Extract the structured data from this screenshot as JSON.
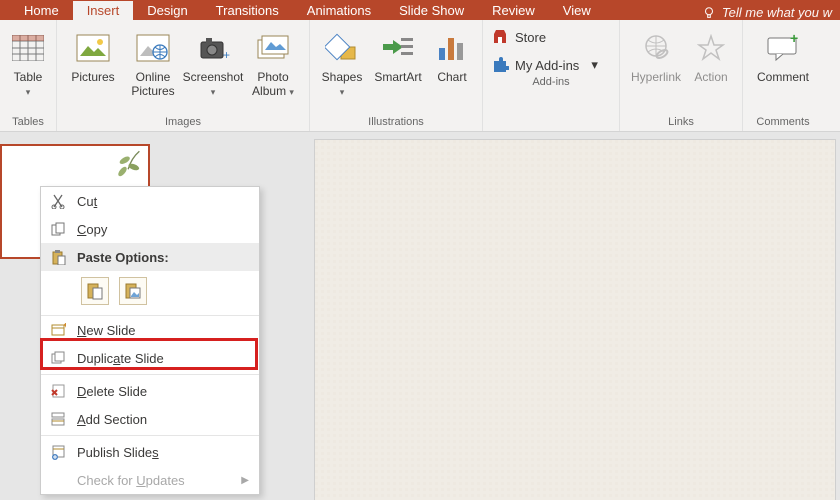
{
  "tabs": {
    "home": "Home",
    "insert": "Insert",
    "design": "Design",
    "transitions": "Transitions",
    "animations": "Animations",
    "slideshow": "Slide Show",
    "review": "Review",
    "view": "View",
    "tellme": "Tell me what you w"
  },
  "ribbon": {
    "tables": {
      "table": "Table",
      "group": "Tables"
    },
    "images": {
      "pictures": "Pictures",
      "online_pictures": "Online Pictures",
      "screenshot": "Screenshot",
      "photo_album": "Photo Album",
      "group": "Images"
    },
    "illustrations": {
      "shapes": "Shapes",
      "smartart": "SmartArt",
      "chart": "Chart",
      "group": "Illustrations"
    },
    "addins": {
      "store": "Store",
      "my_addins": "My Add-ins",
      "group": "Add-ins"
    },
    "links": {
      "hyperlink": "Hyperlink",
      "action": "Action",
      "group": "Links"
    },
    "comments": {
      "comment": "Comment",
      "group": "Comments"
    }
  },
  "context_menu": {
    "cut": "Cut",
    "copy": "Copy",
    "paste_options": "Paste Options:",
    "new_slide": "New Slide",
    "duplicate_slide": "Duplicate Slide",
    "delete_slide": "Delete Slide",
    "add_section": "Add Section",
    "publish_slides": "Publish Slides",
    "check_updates": "Check for Updates"
  },
  "accelerators": {
    "cut": "t",
    "copy": "C",
    "new_slide": "N",
    "duplicate_slide": "a",
    "delete_slide": "D",
    "add_section": "A",
    "publish_slides": "s",
    "check_updates": "U"
  }
}
